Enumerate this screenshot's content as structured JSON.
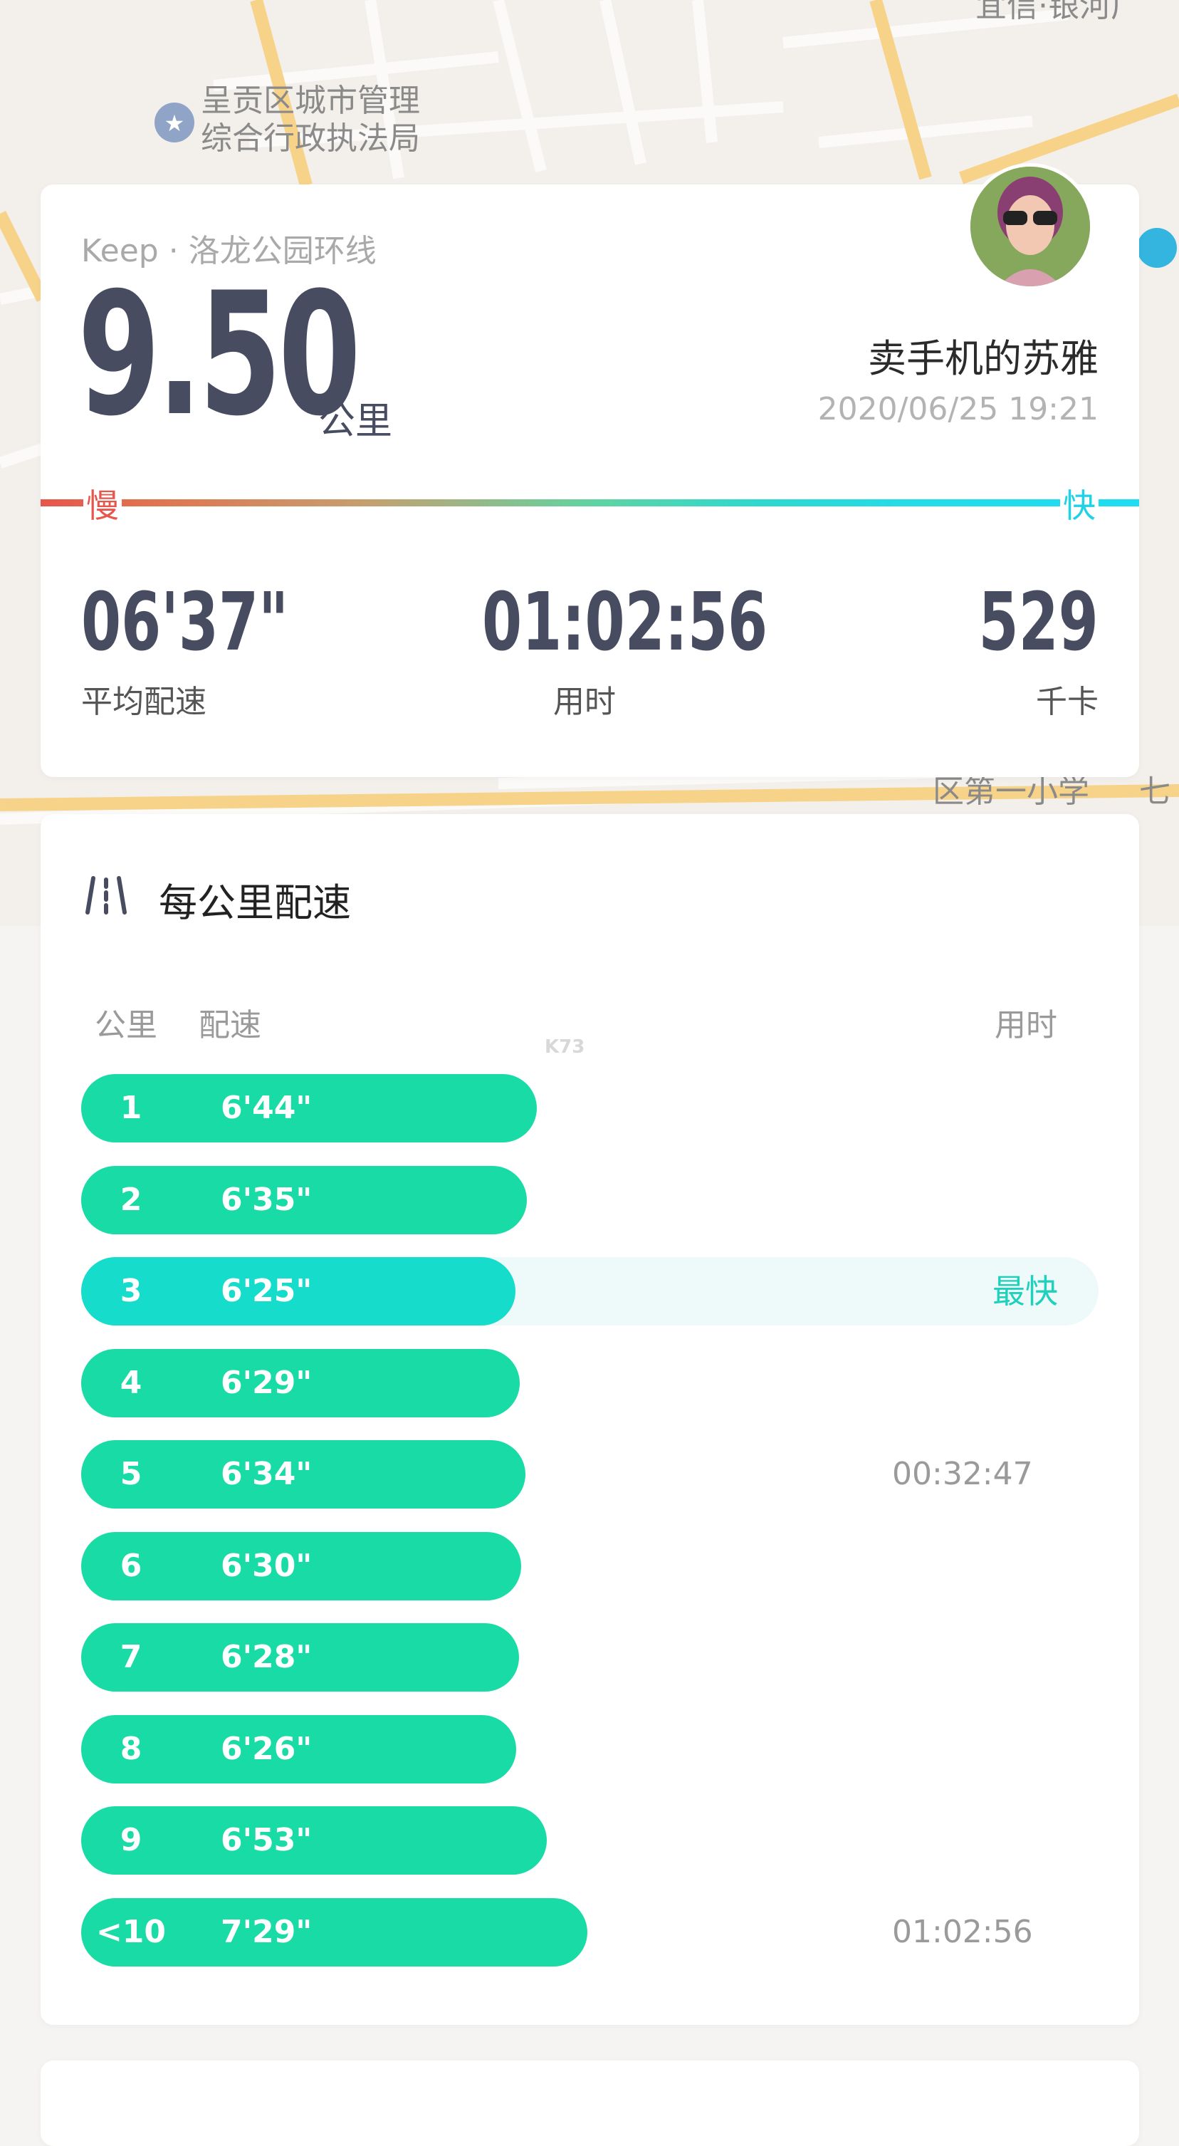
{
  "map": {
    "labels": [
      "呈贡区城市管理",
      "综合行政执法局",
      "宜信·银河广",
      "区第一小学",
      "七"
    ]
  },
  "summary": {
    "source": "Keep · 洛龙公园环线",
    "distance": "9.50",
    "distance_unit": "公里",
    "username": "卖手机的苏雅",
    "datetime": "2020/06/25 19:21",
    "speed_slow": "慢",
    "speed_fast": "快",
    "stats": {
      "pace": {
        "value": "06'37\"",
        "label": "平均配速"
      },
      "duration": {
        "value": "01:02:56",
        "label": "用时"
      },
      "calories": {
        "value": "529",
        "label": "千卡"
      }
    }
  },
  "pace_card": {
    "title": "每公里配速",
    "col_km": "公里",
    "col_pace": "配速",
    "col_time": "用时",
    "watermark": "K73",
    "rows": [
      {
        "km": "1",
        "pace": "6'44\"",
        "seconds": 404,
        "badge": "",
        "time": ""
      },
      {
        "km": "2",
        "pace": "6'35\"",
        "seconds": 395,
        "badge": "",
        "time": ""
      },
      {
        "km": "3",
        "pace": "6'25\"",
        "seconds": 385,
        "badge": "最快",
        "time": ""
      },
      {
        "km": "4",
        "pace": "6'29\"",
        "seconds": 389,
        "badge": "",
        "time": ""
      },
      {
        "km": "5",
        "pace": "6'34\"",
        "seconds": 394,
        "badge": "",
        "time": "00:32:47"
      },
      {
        "km": "6",
        "pace": "6'30\"",
        "seconds": 390,
        "badge": "",
        "time": ""
      },
      {
        "km": "7",
        "pace": "6'28\"",
        "seconds": 388,
        "badge": "",
        "time": ""
      },
      {
        "km": "8",
        "pace": "6'26\"",
        "seconds": 386,
        "badge": "",
        "time": ""
      },
      {
        "km": "9",
        "pace": "6'53\"",
        "seconds": 413,
        "badge": "",
        "time": ""
      },
      {
        "km": "<10",
        "pace": "7'29\"",
        "seconds": 449,
        "badge": "",
        "time": "01:02:56"
      }
    ]
  },
  "colors": {
    "accent": "#19dba6",
    "fastest": "#15dccb",
    "slow": "#e7564c",
    "fast": "#1fd2e6",
    "title": "#474c61"
  }
}
